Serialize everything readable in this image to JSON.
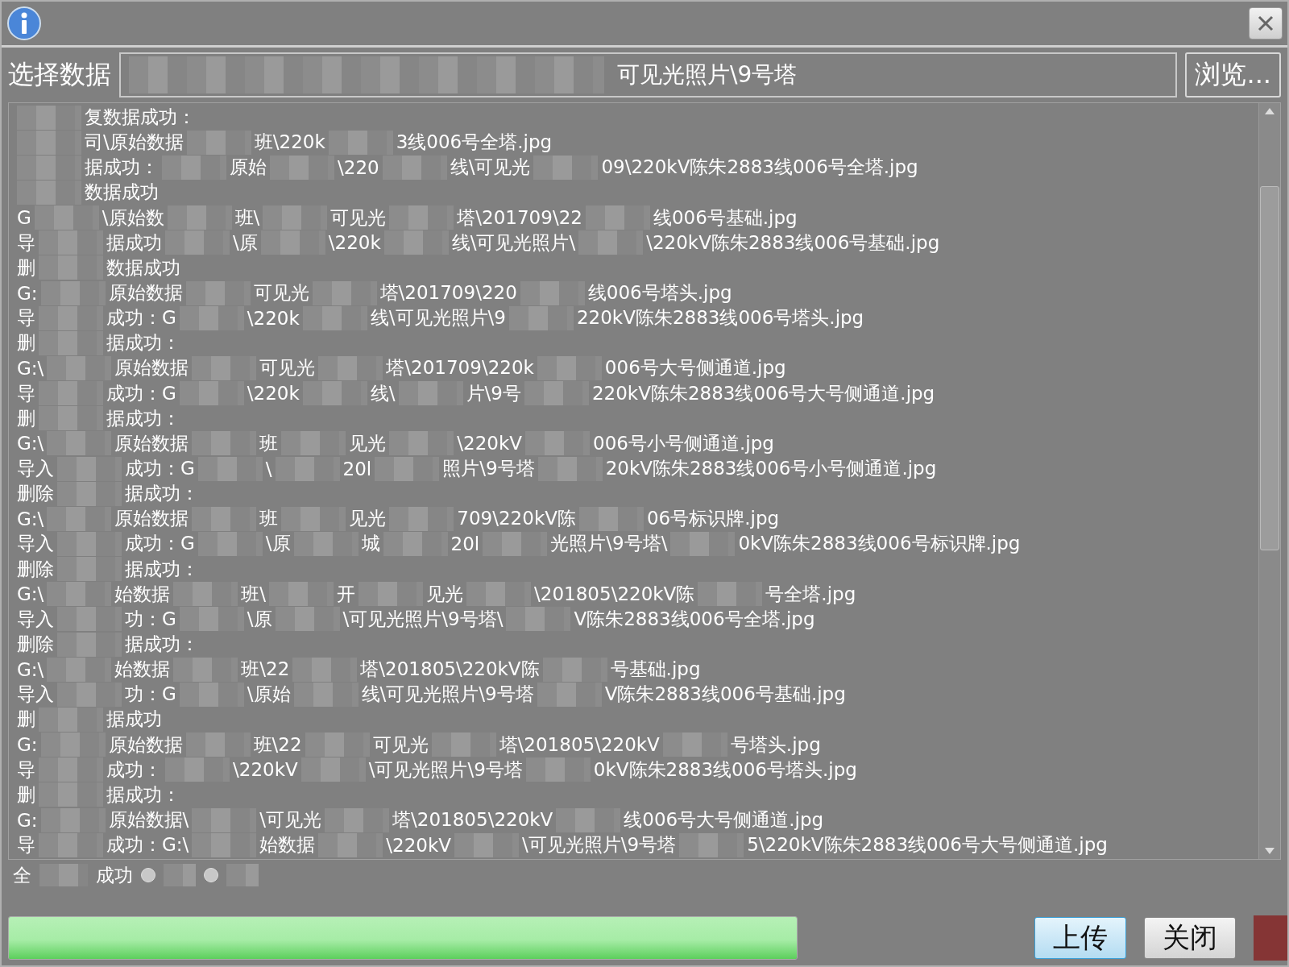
{
  "header": {
    "label": "选择数据",
    "path": "可见光照片\\9号塔",
    "browse": "浏览..."
  },
  "log": [
    {
      "masked_start": true,
      "segments": [
        "复数据成功："
      ]
    },
    {
      "masked_start": true,
      "segments": [
        "司\\原始数据",
        "班\\220k",
        "3线006号全塔.jpg"
      ]
    },
    {
      "masked_start": true,
      "segments": [
        "据成功：",
        "原始",
        "\\220",
        "线\\可见光",
        "09\\220kV陈朱2883线006号全塔.jpg"
      ]
    },
    {
      "masked_start": true,
      "segments": [
        "数据成功"
      ]
    },
    {
      "masked_start": false,
      "segments": [
        "G",
        "\\原始数",
        "班\\",
        "可见光",
        "塔\\201709\\22",
        "线006号基础.jpg"
      ]
    },
    {
      "masked_start": false,
      "segments": [
        "导",
        "据成功",
        "\\原",
        "\\220k",
        "线\\可见光照片\\",
        "\\220kV陈朱2883线006号基础.jpg"
      ]
    },
    {
      "masked_start": false,
      "segments": [
        "删",
        "数据成功"
      ]
    },
    {
      "masked_start": false,
      "segments": [
        "G:",
        "原始数据",
        "可见光",
        "塔\\201709\\220",
        "线006号塔头.jpg"
      ]
    },
    {
      "masked_start": false,
      "segments": [
        "导",
        "成功：G",
        "\\220k",
        "线\\可见光照片\\9",
        "220kV陈朱2883线006号塔头.jpg"
      ]
    },
    {
      "masked_start": false,
      "segments": [
        "删",
        "据成功："
      ]
    },
    {
      "masked_start": false,
      "segments": [
        "G:\\",
        "原始数据",
        "可见光",
        "塔\\201709\\220k",
        "006号大号侧通道.jpg"
      ]
    },
    {
      "masked_start": false,
      "segments": [
        "导",
        "成功：G",
        "\\220k",
        "线\\",
        "片\\9号",
        "220kV陈朱2883线006号大号侧通道.jpg"
      ]
    },
    {
      "masked_start": false,
      "segments": [
        "删",
        "据成功："
      ]
    },
    {
      "masked_start": false,
      "segments": [
        "G:\\",
        "原始数据",
        "班",
        "见光",
        "\\220kV",
        "006号小号侧通道.jpg"
      ]
    },
    {
      "masked_start": false,
      "segments": [
        "导入",
        "成功：G",
        "\\",
        "20l",
        "照片\\9号塔",
        "20kV陈朱2883线006号小号侧通道.jpg"
      ]
    },
    {
      "masked_start": false,
      "segments": [
        "删除",
        "据成功："
      ]
    },
    {
      "masked_start": false,
      "segments": [
        "G:\\",
        "原始数据",
        "班",
        "见光",
        "709\\220kV陈",
        "06号标识牌.jpg"
      ]
    },
    {
      "masked_start": false,
      "segments": [
        "导入",
        "成功：G",
        "\\原",
        "城",
        "20l",
        "光照片\\9号塔\\",
        "0kV陈朱2883线006号标识牌.jpg"
      ]
    },
    {
      "masked_start": false,
      "segments": [
        "删除",
        "据成功："
      ]
    },
    {
      "masked_start": false,
      "segments": [
        "G:\\",
        "始数据",
        "班\\",
        "开",
        "见光",
        "\\201805\\220kV陈",
        "号全塔.jpg"
      ]
    },
    {
      "masked_start": false,
      "segments": [
        "导入",
        "功：G",
        "\\原",
        "\\可见光照片\\9号塔\\",
        "V陈朱2883线006号全塔.jpg"
      ]
    },
    {
      "masked_start": false,
      "segments": [
        "删除",
        "据成功："
      ]
    },
    {
      "masked_start": false,
      "segments": [
        "G:\\",
        "始数据",
        "班\\22",
        "塔\\201805\\220kV陈",
        "号基础.jpg"
      ]
    },
    {
      "masked_start": false,
      "segments": [
        "导入",
        "功：G",
        "\\原始",
        "线\\可见光照片\\9号塔",
        "V陈朱2883线006号基础.jpg"
      ]
    },
    {
      "masked_start": false,
      "segments": [
        "删",
        "据成功"
      ]
    },
    {
      "masked_start": false,
      "segments": [
        "G:",
        "原始数据",
        "班\\22",
        "可见光",
        "塔\\201805\\220kV",
        "号塔头.jpg"
      ]
    },
    {
      "masked_start": false,
      "segments": [
        "导",
        "成功：",
        "\\220kV",
        "\\可见光照片\\9号塔",
        "0kV陈朱2883线006号塔头.jpg"
      ]
    },
    {
      "masked_start": false,
      "segments": [
        "删",
        "据成功："
      ]
    },
    {
      "masked_start": false,
      "segments": [
        "G:",
        "原始数据\\",
        "\\可见光",
        "塔\\201805\\220kV",
        "线006号大号侧通道.jpg"
      ]
    },
    {
      "masked_start": false,
      "segments": [
        "导",
        "成功：G:\\",
        "始数据",
        "\\220kV",
        "\\可见光照片\\9号塔",
        "5\\220kV陈朱2883线006号大号侧通道.jpg"
      ]
    }
  ],
  "filters": [
    {
      "label": "全"
    },
    {
      "label": "成功",
      "selected": false
    },
    {
      "selected": false
    }
  ],
  "progress": {
    "level": 1
  },
  "buttons": [
    {
      "label": "上传",
      "focused": true
    },
    {
      "label": "关闭",
      "focused": false
    }
  ]
}
